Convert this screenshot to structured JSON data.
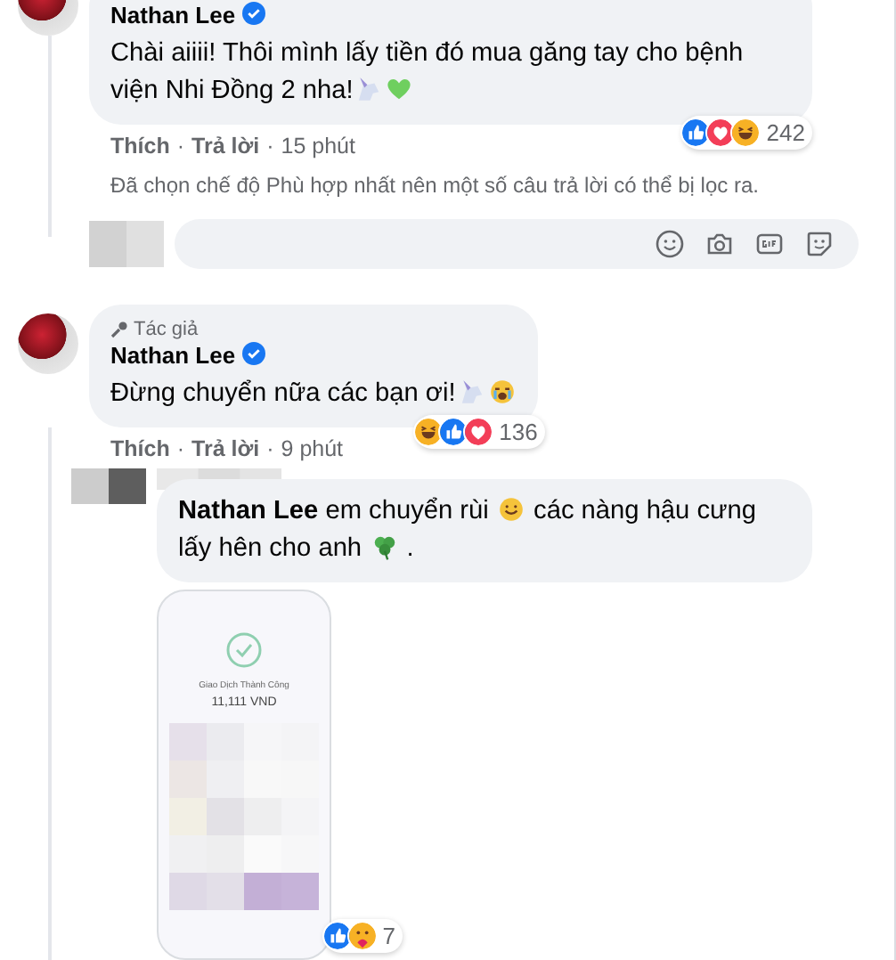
{
  "comments": [
    {
      "author": "Nathan Lee",
      "verified": true,
      "text": "Chài aiiii! Thôi mình lấy tiền đó mua găng tay cho bệnh viện Nhi Đồng 2 nha!",
      "text_emojis": [
        {
          "kind": "unicorn"
        },
        {
          "kind": "green-heart"
        }
      ],
      "actions": [
        "Thích",
        "Trả lời"
      ],
      "time": "15 phút",
      "reactions": [
        {
          "kind": "like"
        },
        {
          "kind": "love"
        },
        {
          "kind": "haha"
        }
      ],
      "reaction_count": "242",
      "separator": "·",
      "note": "Đã chọn chế độ Phù hợp nhất nên một số câu trả lời có thể bị lọc ra."
    },
    {
      "author": "Nathan Lee",
      "verified": true,
      "author_badge": "Tác giả",
      "text": "Đừng chuyển nữa các bạn ơi!",
      "text_emojis": [
        {
          "kind": "unicorn"
        },
        {
          "kind": "crying"
        }
      ],
      "actions": [
        "Thích",
        "Trả lời"
      ],
      "time": "9 phút",
      "reactions": [
        {
          "kind": "haha"
        },
        {
          "kind": "like"
        },
        {
          "kind": "love"
        }
      ],
      "reaction_count": "136",
      "separator": "·",
      "reply": {
        "mention": "Nathan Lee",
        "text_parts": [
          {
            "kind": "text",
            "text": "em chuyển rùi"
          },
          {
            "kind": "smile"
          },
          {
            "kind": "text",
            "text": "các nàng hậu cưng lấy hên cho anh"
          },
          {
            "kind": "clover"
          },
          {
            "kind": "text",
            "text": "."
          }
        ],
        "attachment": {
          "title": "Giao Dịch Thành Công",
          "amount": "11,111 VND"
        },
        "reactions": [
          {
            "kind": "like"
          },
          {
            "kind": "care"
          }
        ],
        "reaction_count": "7"
      }
    }
  ]
}
